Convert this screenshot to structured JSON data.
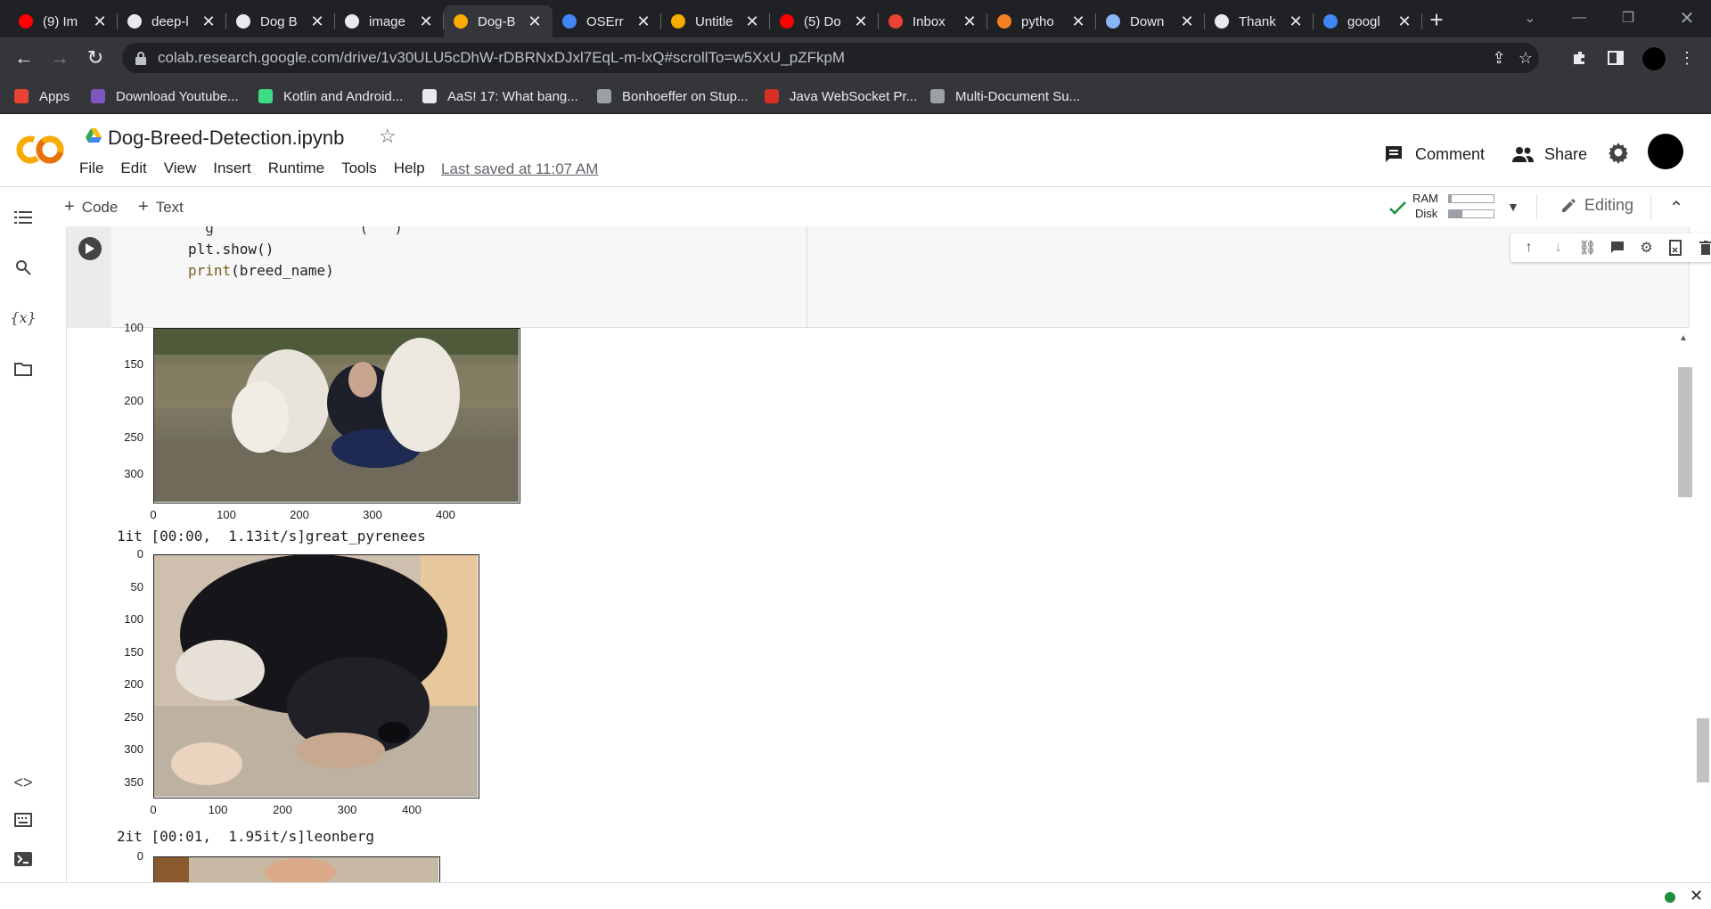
{
  "browser": {
    "tabs": [
      {
        "title": "(9) Im",
        "icon": "youtube-icon",
        "color": "#ff0000"
      },
      {
        "title": "deep-l",
        "icon": "github-icon",
        "color": "#e8eaed"
      },
      {
        "title": "Dog B",
        "icon": "dev-icon",
        "color": "#e8eaed"
      },
      {
        "title": "image",
        "icon": "chart-icon",
        "color": "#e8eaed"
      },
      {
        "title": "Dog-B",
        "icon": "colab-icon",
        "color": "#f9ab00",
        "active": true
      },
      {
        "title": "OSErr",
        "icon": "google-icon",
        "color": "#4285f4"
      },
      {
        "title": "Untitle",
        "icon": "colab-icon",
        "color": "#f9ab00"
      },
      {
        "title": "(5) Do",
        "icon": "youtube-icon",
        "color": "#ff0000"
      },
      {
        "title": "Inbox",
        "icon": "gmail-icon",
        "color": "#ea4335"
      },
      {
        "title": "pytho",
        "icon": "stackoverflow-icon",
        "color": "#f48024"
      },
      {
        "title": "Down",
        "icon": "download-icon",
        "color": "#8ab4f8"
      },
      {
        "title": "Thank",
        "icon": "globe-icon",
        "color": "#e8eaed"
      },
      {
        "title": "googl",
        "icon": "google-icon",
        "color": "#4285f4"
      }
    ],
    "url": "colab.research.google.com/drive/1v30ULU5cDhW-rDBRNxDJxl7EqL-m-lxQ#scrollTo=w5XxU_pZFkpM",
    "bookmarks": [
      {
        "label": "Apps",
        "icon": "apps-grid-icon"
      },
      {
        "label": "Download Youtube...",
        "icon": "kv-icon"
      },
      {
        "label": "Kotlin and Android...",
        "icon": "android-icon"
      },
      {
        "label": "AaS! 17: What bang...",
        "icon": "s-icon"
      },
      {
        "label": "Bonhoeffer on Stup...",
        "icon": "globe-icon"
      },
      {
        "label": "Java WebSocket Pr...",
        "icon": "pn-icon"
      },
      {
        "label": "Multi-Document Su...",
        "icon": "globe-icon"
      }
    ]
  },
  "colab": {
    "notebook_name": "Dog-Breed-Detection.ipynb",
    "menu": [
      "File",
      "Edit",
      "View",
      "Insert",
      "Runtime",
      "Tools",
      "Help"
    ],
    "last_saved": "Last saved at 11:07 AM",
    "comment_label": "Comment",
    "share_label": "Share",
    "add_code": "Code",
    "add_text": "Text",
    "ram_label": "RAM",
    "disk_label": "Disk",
    "ram_usage": 0.05,
    "disk_usage": 0.3,
    "editing_label": "Editing"
  },
  "cell": {
    "code_partial": "  g                 (   )",
    "code_line1": "plt.show()",
    "code_line2_fn": "print",
    "code_line2_rest": "(breed_name)"
  },
  "output": {
    "plot1": {
      "yticks": [
        "100",
        "150",
        "200",
        "250",
        "300"
      ],
      "xticks": [
        "0",
        "100",
        "200",
        "300",
        "400"
      ],
      "image_desc_icon": "dogs-photo"
    },
    "log1": "1it [00:00,  1.13it/s]great_pyrenees",
    "plot2": {
      "yticks": [
        "0",
        "50",
        "100",
        "150",
        "200",
        "250",
        "300",
        "350"
      ],
      "xticks": [
        "0",
        "100",
        "200",
        "300",
        "400"
      ]
    },
    "log2": "2it [00:01,  1.95it/s]leonberg",
    "plot3": {
      "yticks": [
        "0"
      ]
    }
  }
}
